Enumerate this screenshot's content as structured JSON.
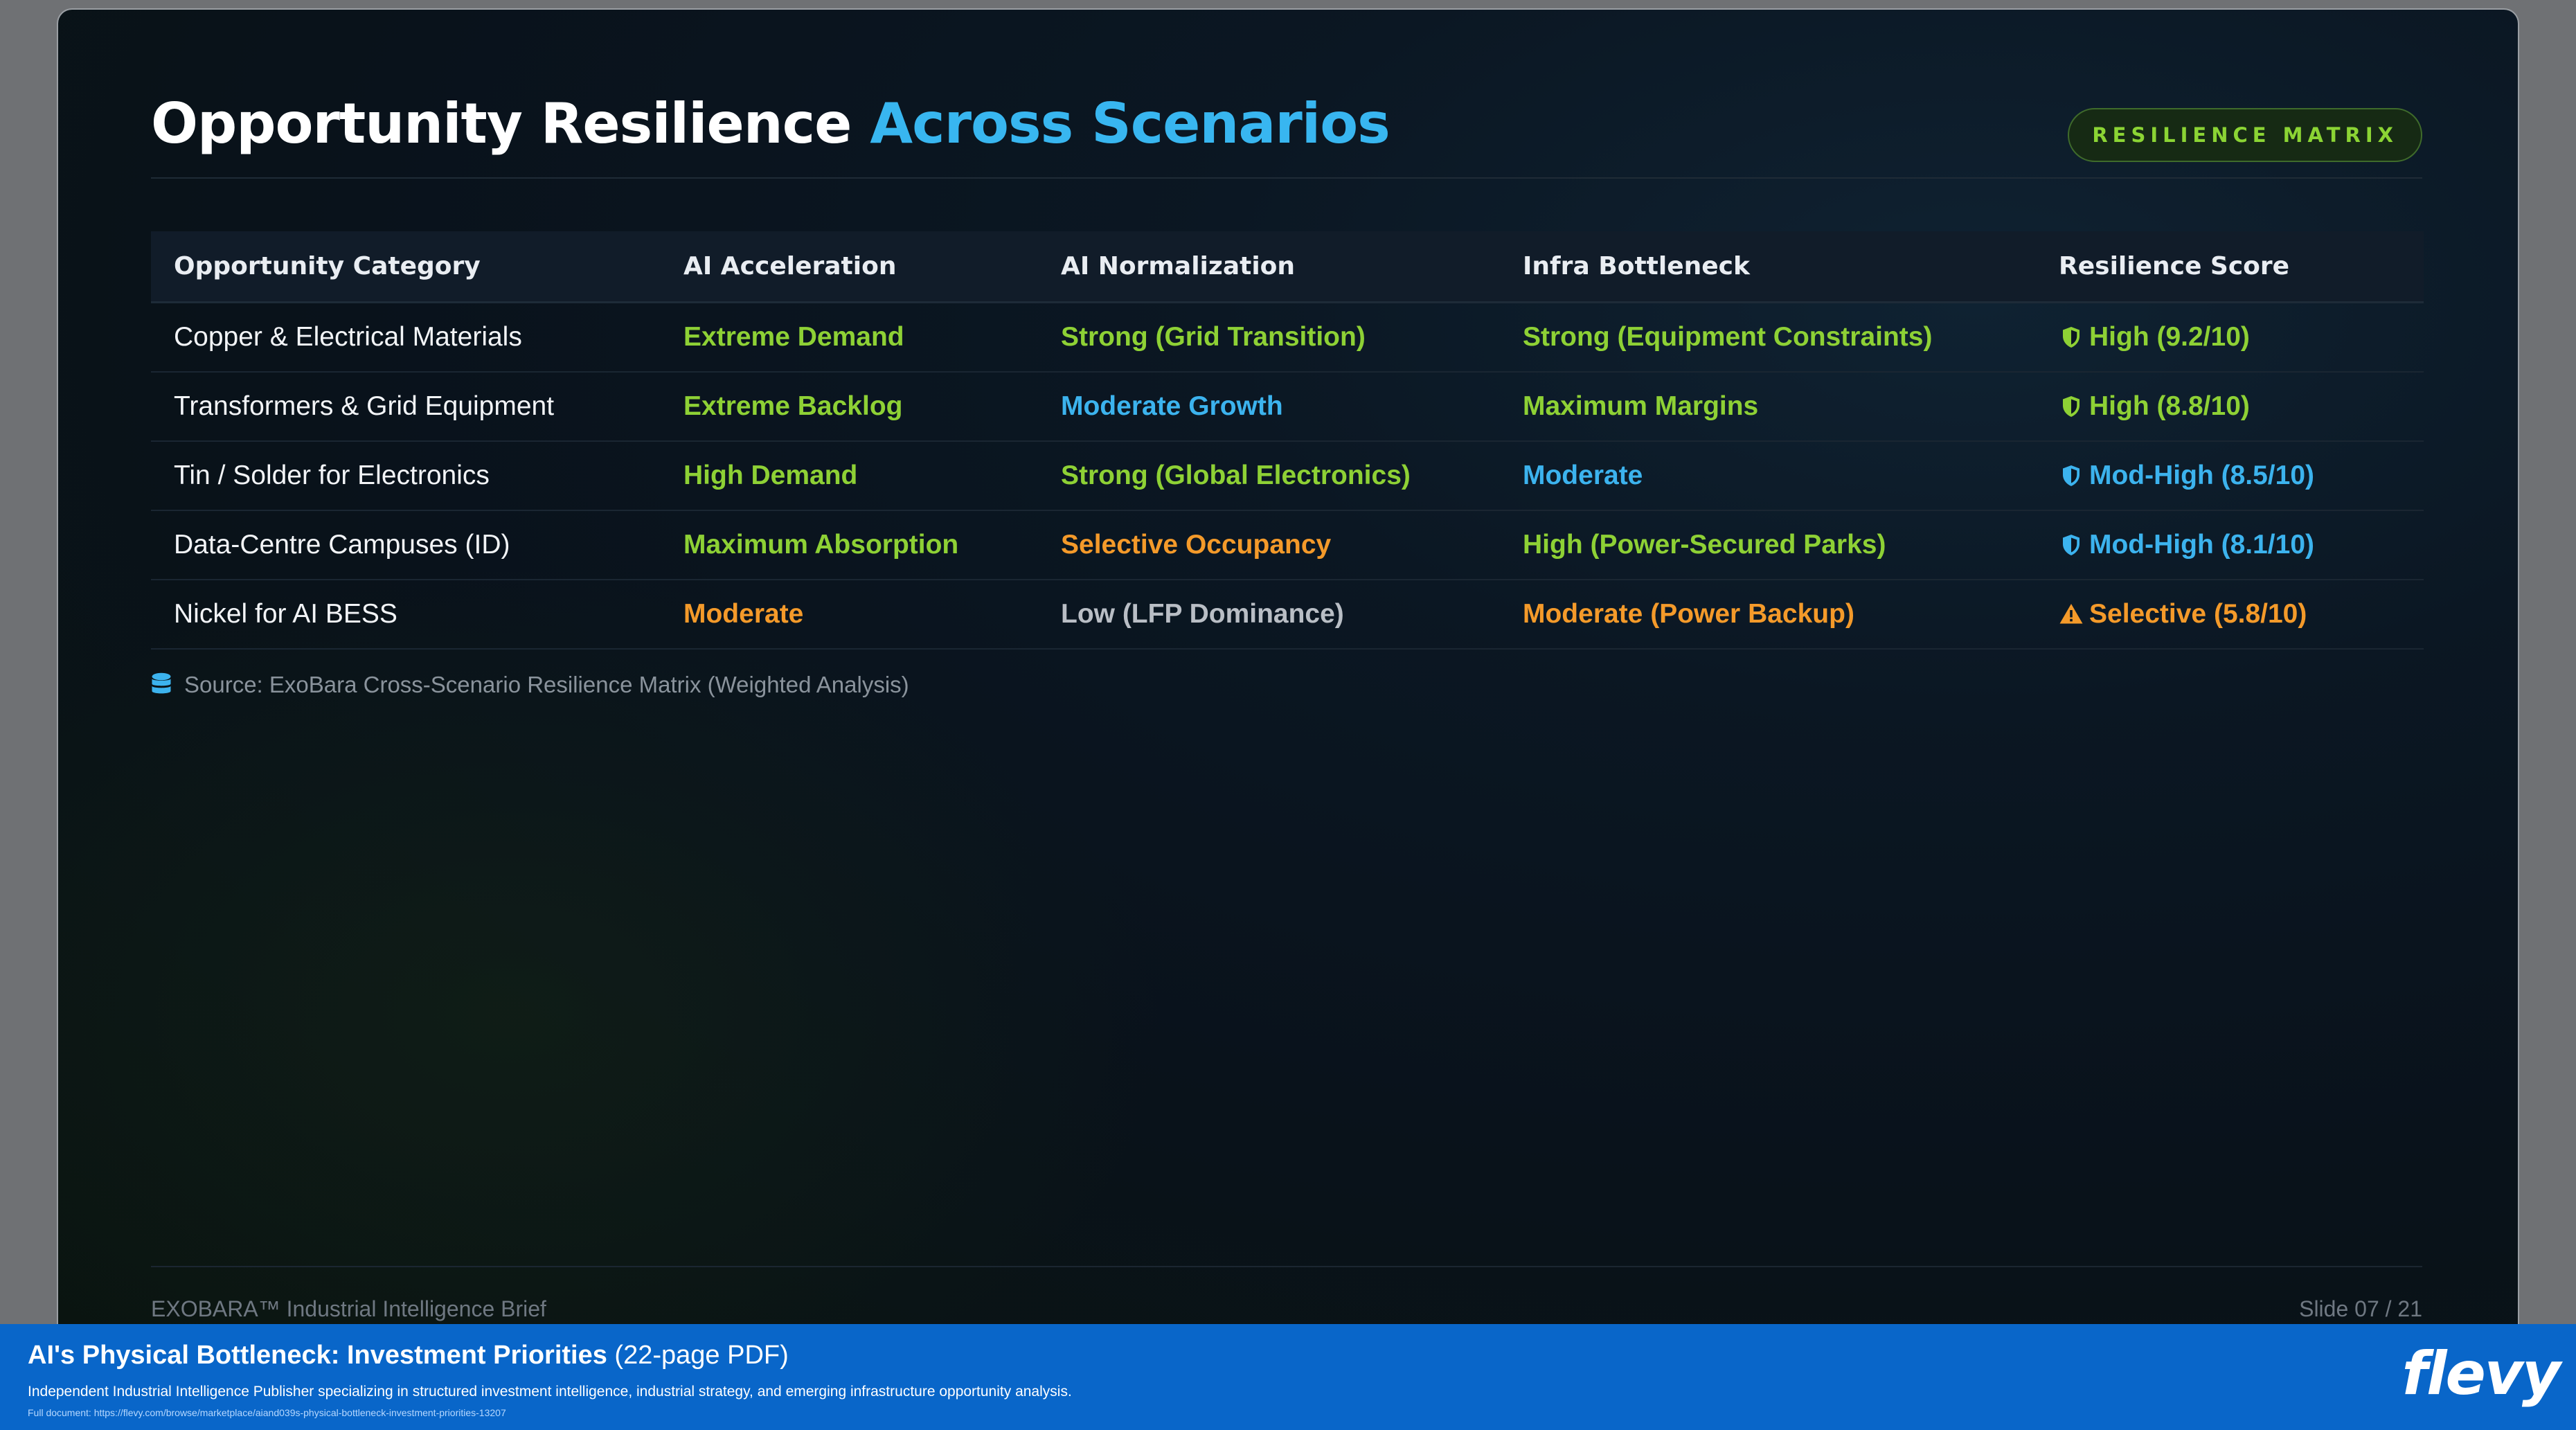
{
  "slide": {
    "title_main": "Opportunity Resilience",
    "title_accent": "Across Scenarios",
    "badge": "RESILIENCE MATRIX",
    "source": "Source: ExoBara Cross-Scenario Resilience Matrix (Weighted Analysis)",
    "footer_left": "EXOBARA™ Industrial Intelligence Brief",
    "footer_right": "Slide 07 / 21"
  },
  "table": {
    "headers": [
      "Opportunity Category",
      "AI Acceleration",
      "AI Normalization",
      "Infra Bottleneck",
      "Resilience Score"
    ],
    "rows": [
      {
        "category": "Copper & Electrical Materials",
        "ai_acceleration": {
          "text": "Extreme Demand",
          "tone": "green"
        },
        "ai_normalization": {
          "text": "Strong (Grid Transition)",
          "tone": "green"
        },
        "infra_bottleneck": {
          "text": "Strong (Equipment Constraints)",
          "tone": "green"
        },
        "score": {
          "text": "High (9.2/10)",
          "tone": "green",
          "icon": "shield-icon"
        }
      },
      {
        "category": "Transformers & Grid Equipment",
        "ai_acceleration": {
          "text": "Extreme Backlog",
          "tone": "green"
        },
        "ai_normalization": {
          "text": "Moderate Growth",
          "tone": "blue"
        },
        "infra_bottleneck": {
          "text": "Maximum Margins",
          "tone": "green"
        },
        "score": {
          "text": "High (8.8/10)",
          "tone": "green",
          "icon": "shield-icon"
        }
      },
      {
        "category": "Tin / Solder for Electronics",
        "ai_acceleration": {
          "text": "High Demand",
          "tone": "green"
        },
        "ai_normalization": {
          "text": "Strong (Global Electronics)",
          "tone": "green"
        },
        "infra_bottleneck": {
          "text": "Moderate",
          "tone": "blue"
        },
        "score": {
          "text": "Mod-High (8.5/10)",
          "tone": "blue",
          "icon": "shield-half-icon"
        }
      },
      {
        "category": "Data-Centre Campuses (ID)",
        "ai_acceleration": {
          "text": "Maximum Absorption",
          "tone": "green"
        },
        "ai_normalization": {
          "text": "Selective Occupancy",
          "tone": "orange"
        },
        "infra_bottleneck": {
          "text": "High (Power-Secured Parks)",
          "tone": "green"
        },
        "score": {
          "text": "Mod-High (8.1/10)",
          "tone": "blue",
          "icon": "shield-half-icon"
        }
      },
      {
        "category": "Nickel for AI BESS",
        "ai_acceleration": {
          "text": "Moderate",
          "tone": "orange"
        },
        "ai_normalization": {
          "text": "Low (LFP Dominance)",
          "tone": "gray"
        },
        "infra_bottleneck": {
          "text": "Moderate (Power Backup)",
          "tone": "orange"
        },
        "score": {
          "text": "Selective (5.8/10)",
          "tone": "orange",
          "icon": "warning-icon"
        }
      }
    ]
  },
  "colors": {
    "green": "#8ed135",
    "blue": "#3cb3ee",
    "orange": "#f49a2a",
    "gray": "#b9bec5",
    "banner": "#0966c9"
  },
  "banner": {
    "title_bold": "AI's Physical Bottleneck: Investment Priorities",
    "title_suffix": " (22-page PDF)",
    "description": "Independent Industrial Intelligence Publisher specializing in structured investment intelligence, industrial strategy, and emerging infrastructure opportunity analysis.",
    "url": "Full document: https://flevy.com/browse/marketplace/aiand039s-physical-bottleneck-investment-priorities-13207",
    "brand": "flevy"
  }
}
